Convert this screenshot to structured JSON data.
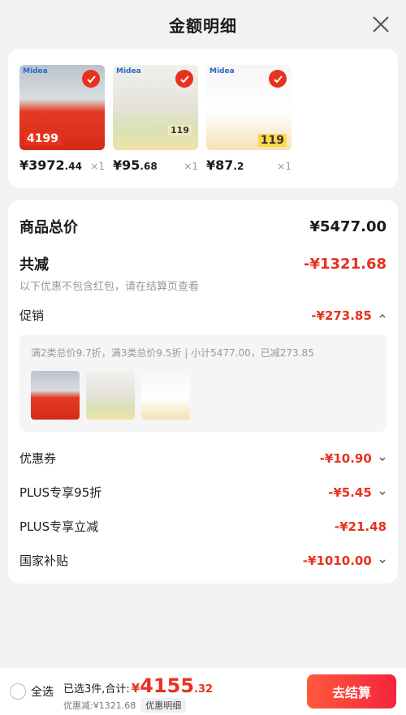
{
  "header": {
    "title": "金额明细"
  },
  "products": [
    {
      "price_int": "¥3972",
      "price_dec": ".44",
      "qty": "×1",
      "brand": "Midea",
      "tag": "4199"
    },
    {
      "price_int": "¥95",
      "price_dec": ".68",
      "qty": "×1",
      "brand": "Midea",
      "tag": "119"
    },
    {
      "price_int": "¥87",
      "price_dec": ".2",
      "qty": "×1",
      "brand": "Midea",
      "tag": "119"
    }
  ],
  "summary": {
    "goods_total_label": "商品总价",
    "goods_total_value": "¥5477.00",
    "total_discount_label": "共减",
    "total_discount_value": "-¥1321.68",
    "discount_note": "以下优惠不包含红包，请在结算页查看",
    "promo_label": "促销",
    "promo_value": "-¥273.85",
    "promo_detail": "满2类总价9.7折，满3类总价9.5折 | 小计5477.00，已减273.85",
    "coupon_label": "优惠券",
    "coupon_value": "-¥10.90",
    "plus95_label": "PLUS专享95折",
    "plus95_value": "-¥5.45",
    "plus_instant_label": "PLUS专享立减",
    "plus_instant_value": "-¥21.48",
    "subsidy_label": "国家补贴",
    "subsidy_value": "-¥1010.00"
  },
  "bottom": {
    "select_all": "全选",
    "selected_prefix": "已选3件,合计:",
    "total_symbol": "¥",
    "total_int": "4155",
    "total_dec": ".32",
    "saved": "优惠减:¥1321.68",
    "detail_chip": "优惠明细",
    "checkout": "去结算"
  },
  "colors": {
    "accent": "#e8311e",
    "background": "#f2f2f2"
  }
}
